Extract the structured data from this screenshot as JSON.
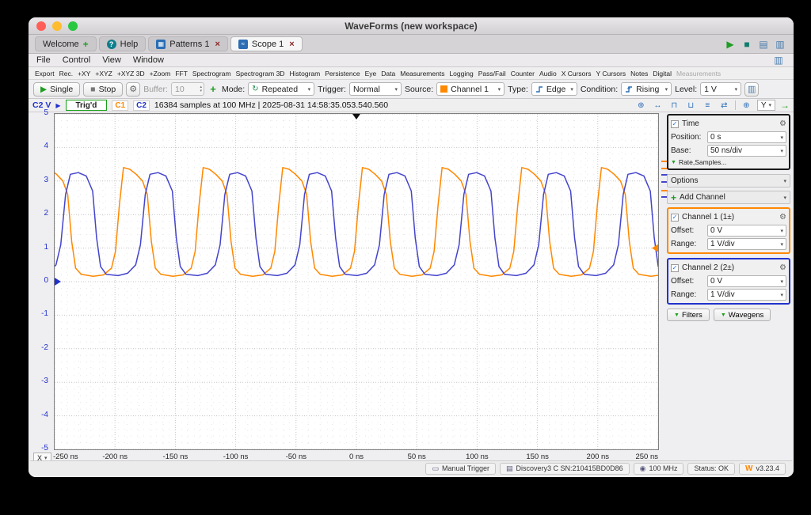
{
  "window_title": "WaveForms (new workspace)",
  "tabs": {
    "welcome": "Welcome",
    "help": "Help",
    "patterns": "Patterns 1",
    "scope": "Scope 1"
  },
  "menus": [
    "File",
    "Control",
    "View",
    "Window"
  ],
  "view_toolbar": [
    "Export",
    "Rec.",
    "+XY",
    "+XYZ",
    "+XYZ 3D",
    "+Zoom",
    "FFT",
    "Spectrogram",
    "Spectrogram 3D",
    "Histogram",
    "Persistence",
    "Eye",
    "Data",
    "Measurements",
    "Logging",
    "Pass/Fail",
    "Counter",
    "Audio",
    "X Cursors",
    "Y Cursors",
    "Notes",
    "Digital"
  ],
  "view_toolbar_disabled": "Measurements",
  "controls": {
    "single": "Single",
    "stop": "Stop",
    "buffer_label": "Buffer:",
    "buffer_value": "10",
    "mode_label": "Mode:",
    "mode_value": "Repeated",
    "trigger_label": "Trigger:",
    "trigger_value": "Normal",
    "source_label": "Source:",
    "source_value": "Channel 1",
    "type_label": "Type:",
    "type_value": "Edge",
    "condition_label": "Condition:",
    "condition_value": "Rising",
    "level_label": "Level:",
    "level_value": "1 V"
  },
  "status_row": {
    "vertical_axis": "C2 V",
    "trig_status": "Trig'd",
    "c1_badge": "C1",
    "c2_badge": "C2",
    "acquisition_info": "16384 samples at 100 MHz | 2025-08-31 14:58:35.053.540.560",
    "y_axis_selector": "Y",
    "x_axis_selector": "X"
  },
  "chart_data": {
    "type": "line",
    "x_unit": "ns",
    "x_range": [
      -250,
      250
    ],
    "y_range": [
      -5,
      5
    ],
    "time_base": "50 ns/div",
    "volts_per_div": "1 V/div",
    "grid": true,
    "x_ticks": [
      "-250 ns",
      "-200 ns",
      "-150 ns",
      "-100 ns",
      "-50 ns",
      "0 ns",
      "50 ns",
      "100 ns",
      "150 ns",
      "200 ns",
      "250 ns"
    ],
    "y_ticks": [
      "5",
      "4",
      "3",
      "2",
      "1",
      "0",
      "-1",
      "-2",
      "-3",
      "-4",
      "-5"
    ],
    "trigger": {
      "position_ns": 0,
      "level_v": 1,
      "color": "#ff8800"
    },
    "c2_zero_marker_v": 0,
    "series": [
      {
        "name": "Channel 1",
        "color": "#ff8800",
        "period_ns": 66,
        "peak_anchor_ns": 5,
        "high_v": 3.4,
        "low_v": 0.16,
        "waypoints": [
          [
            0,
            3.4
          ],
          [
            0.08,
            3.35
          ],
          [
            0.16,
            3.2
          ],
          [
            0.24,
            3.0
          ],
          [
            0.3,
            2.6
          ],
          [
            0.35,
            1.2
          ],
          [
            0.4,
            0.4
          ],
          [
            0.47,
            0.22
          ],
          [
            0.62,
            0.16
          ],
          [
            0.75,
            0.2
          ],
          [
            0.85,
            0.4
          ],
          [
            0.9,
            0.9
          ],
          [
            0.95,
            2.3
          ]
        ]
      },
      {
        "name": "Channel 2",
        "color": "#4444cc",
        "period_ns": 66,
        "peak_anchor_ns": 27,
        "high_v": 3.25,
        "low_v": 0.18,
        "waypoints": [
          [
            0,
            3.2
          ],
          [
            0.1,
            3.25
          ],
          [
            0.2,
            3.15
          ],
          [
            0.28,
            2.7
          ],
          [
            0.33,
            1.3
          ],
          [
            0.38,
            0.45
          ],
          [
            0.45,
            0.22
          ],
          [
            0.6,
            0.18
          ],
          [
            0.72,
            0.25
          ],
          [
            0.82,
            0.5
          ],
          [
            0.88,
            1.1
          ],
          [
            0.94,
            2.6
          ]
        ]
      }
    ],
    "side_markers": [
      {
        "color": "#ff8800",
        "v": 3.55
      },
      {
        "color": "#ff8800",
        "v": 3.35
      },
      {
        "color": "#4444cc",
        "v": 3.15
      },
      {
        "color": "#4444cc",
        "v": 2.95
      },
      {
        "color": "#ff8800",
        "v": 2.7
      },
      {
        "color": "#4444cc",
        "v": 2.5
      }
    ]
  },
  "right_panel": {
    "time": {
      "label": "Time",
      "position_label": "Position:",
      "position_value": "0 s",
      "base_label": "Base:",
      "base_value": "50 ns/div",
      "rate_samples": "Rate,Samples..."
    },
    "options_label": "Options",
    "add_channel_label": "Add Channel",
    "channel1": {
      "label": "Channel 1 (1±)",
      "offset_label": "Offset:",
      "offset_value": "0 V",
      "range_label": "Range:",
      "range_value": "1 V/div"
    },
    "channel2": {
      "label": "Channel 2 (2±)",
      "offset_label": "Offset:",
      "offset_value": "0 V",
      "range_label": "Range:",
      "range_value": "1 V/div"
    },
    "filters_label": "Filters",
    "wavegens_label": "Wavegens"
  },
  "bottom_bar": {
    "manual_trigger": "Manual Trigger",
    "device": "Discovery3 C SN:210415BD0D86",
    "frequency": "100 MHz",
    "status": "Status: OK",
    "logo": "W",
    "version": "v3.23.4"
  },
  "icons": {
    "play": "▶",
    "stop_square": "■",
    "gear": "⚙",
    "plus": "+",
    "help": "?",
    "close": "×",
    "check": "✓",
    "caret": "▾",
    "spin_up": "▴",
    "spin_down": "▾",
    "repeat": "↻",
    "green_down": "▼",
    "green_right": "→",
    "zoom": "⊕",
    "fit_h": "↔",
    "fit_top": "⊓",
    "fit_bottom": "⊔",
    "lines": "≡",
    "swap": "⇄",
    "window1": "▤",
    "window2": "▥",
    "chip": "◉",
    "board": "▤",
    "button": "▭",
    "wave": "≈",
    "pattern": "▦"
  }
}
